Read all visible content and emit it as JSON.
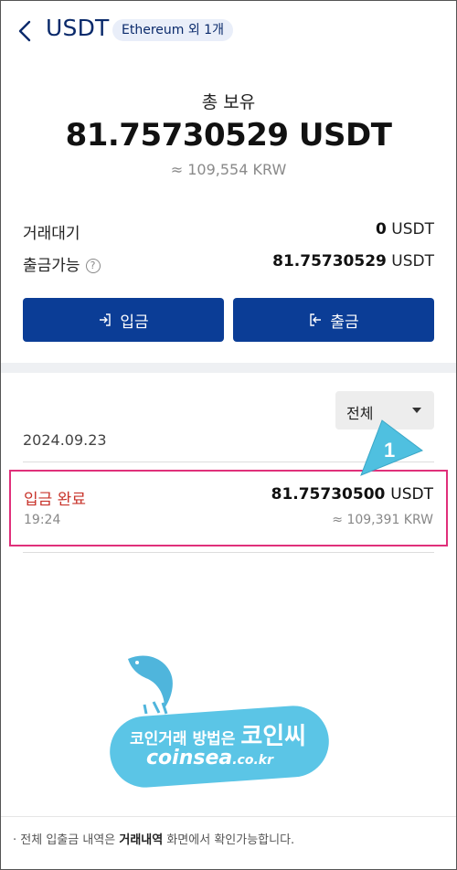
{
  "header": {
    "title": "USDT",
    "network_chip": "Ethereum 외 1개"
  },
  "balance": {
    "label": "총 보유",
    "amount": "81.75730529 USDT",
    "krw": "≈ 109,554 KRW"
  },
  "rows": [
    {
      "label": "거래대기",
      "value_num": "0",
      "unit": "USDT"
    },
    {
      "label": "출금가능",
      "value_num": "81.75730529",
      "unit": "USDT"
    }
  ],
  "actions": {
    "deposit": "입금",
    "withdraw": "출금"
  },
  "filter": {
    "selected": "전체"
  },
  "history": {
    "date": "2024.09.23",
    "items": [
      {
        "status": "입금 완료",
        "time": "19:24",
        "amount_num": "81.75730500",
        "unit": "USDT",
        "krw": "≈ 109,391 KRW"
      }
    ]
  },
  "annotation": {
    "number": "1"
  },
  "watermark": {
    "line1_a": "코인거래 방법은",
    "line1_b": "코인씨",
    "line2_a": "coinsea",
    "line2_b": ".co.kr"
  },
  "footer": {
    "prefix": "· 전체 입출금 내역은",
    "link": "거래내역",
    "suffix": "화면에서 확인가능합니다."
  },
  "colors": {
    "primary": "#0b3d96",
    "status_red": "#c8342b",
    "highlight": "#e0307a",
    "watermark": "#5bc5e6"
  },
  "icons": {
    "back": "chevron-left-icon",
    "help": "question-circle-icon",
    "deposit": "login-icon",
    "withdraw": "logout-icon",
    "caret": "caret-down-icon"
  }
}
